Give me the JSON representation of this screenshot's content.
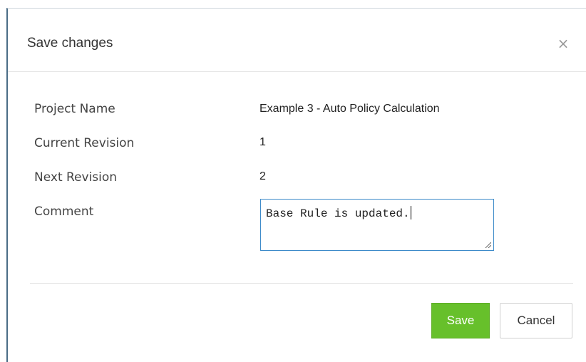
{
  "dialog": {
    "title": "Save changes",
    "close_glyph": "×",
    "close_icon": "close-icon"
  },
  "fields": {
    "project_name": {
      "label": "Project Name",
      "value": "Example 3 - Auto Policy Calculation"
    },
    "current_revision": {
      "label": "Current Revision",
      "value": "1"
    },
    "next_revision": {
      "label": "Next Revision",
      "value": "2"
    },
    "comment": {
      "label": "Comment",
      "value": "Base Rule is updated."
    }
  },
  "buttons": {
    "save_label": "Save",
    "cancel_label": "Cancel"
  },
  "colors": {
    "save_button": "#67c02b",
    "input_focus_border": "#3c8ac9",
    "dialog_left_border": "#4a6c86"
  }
}
